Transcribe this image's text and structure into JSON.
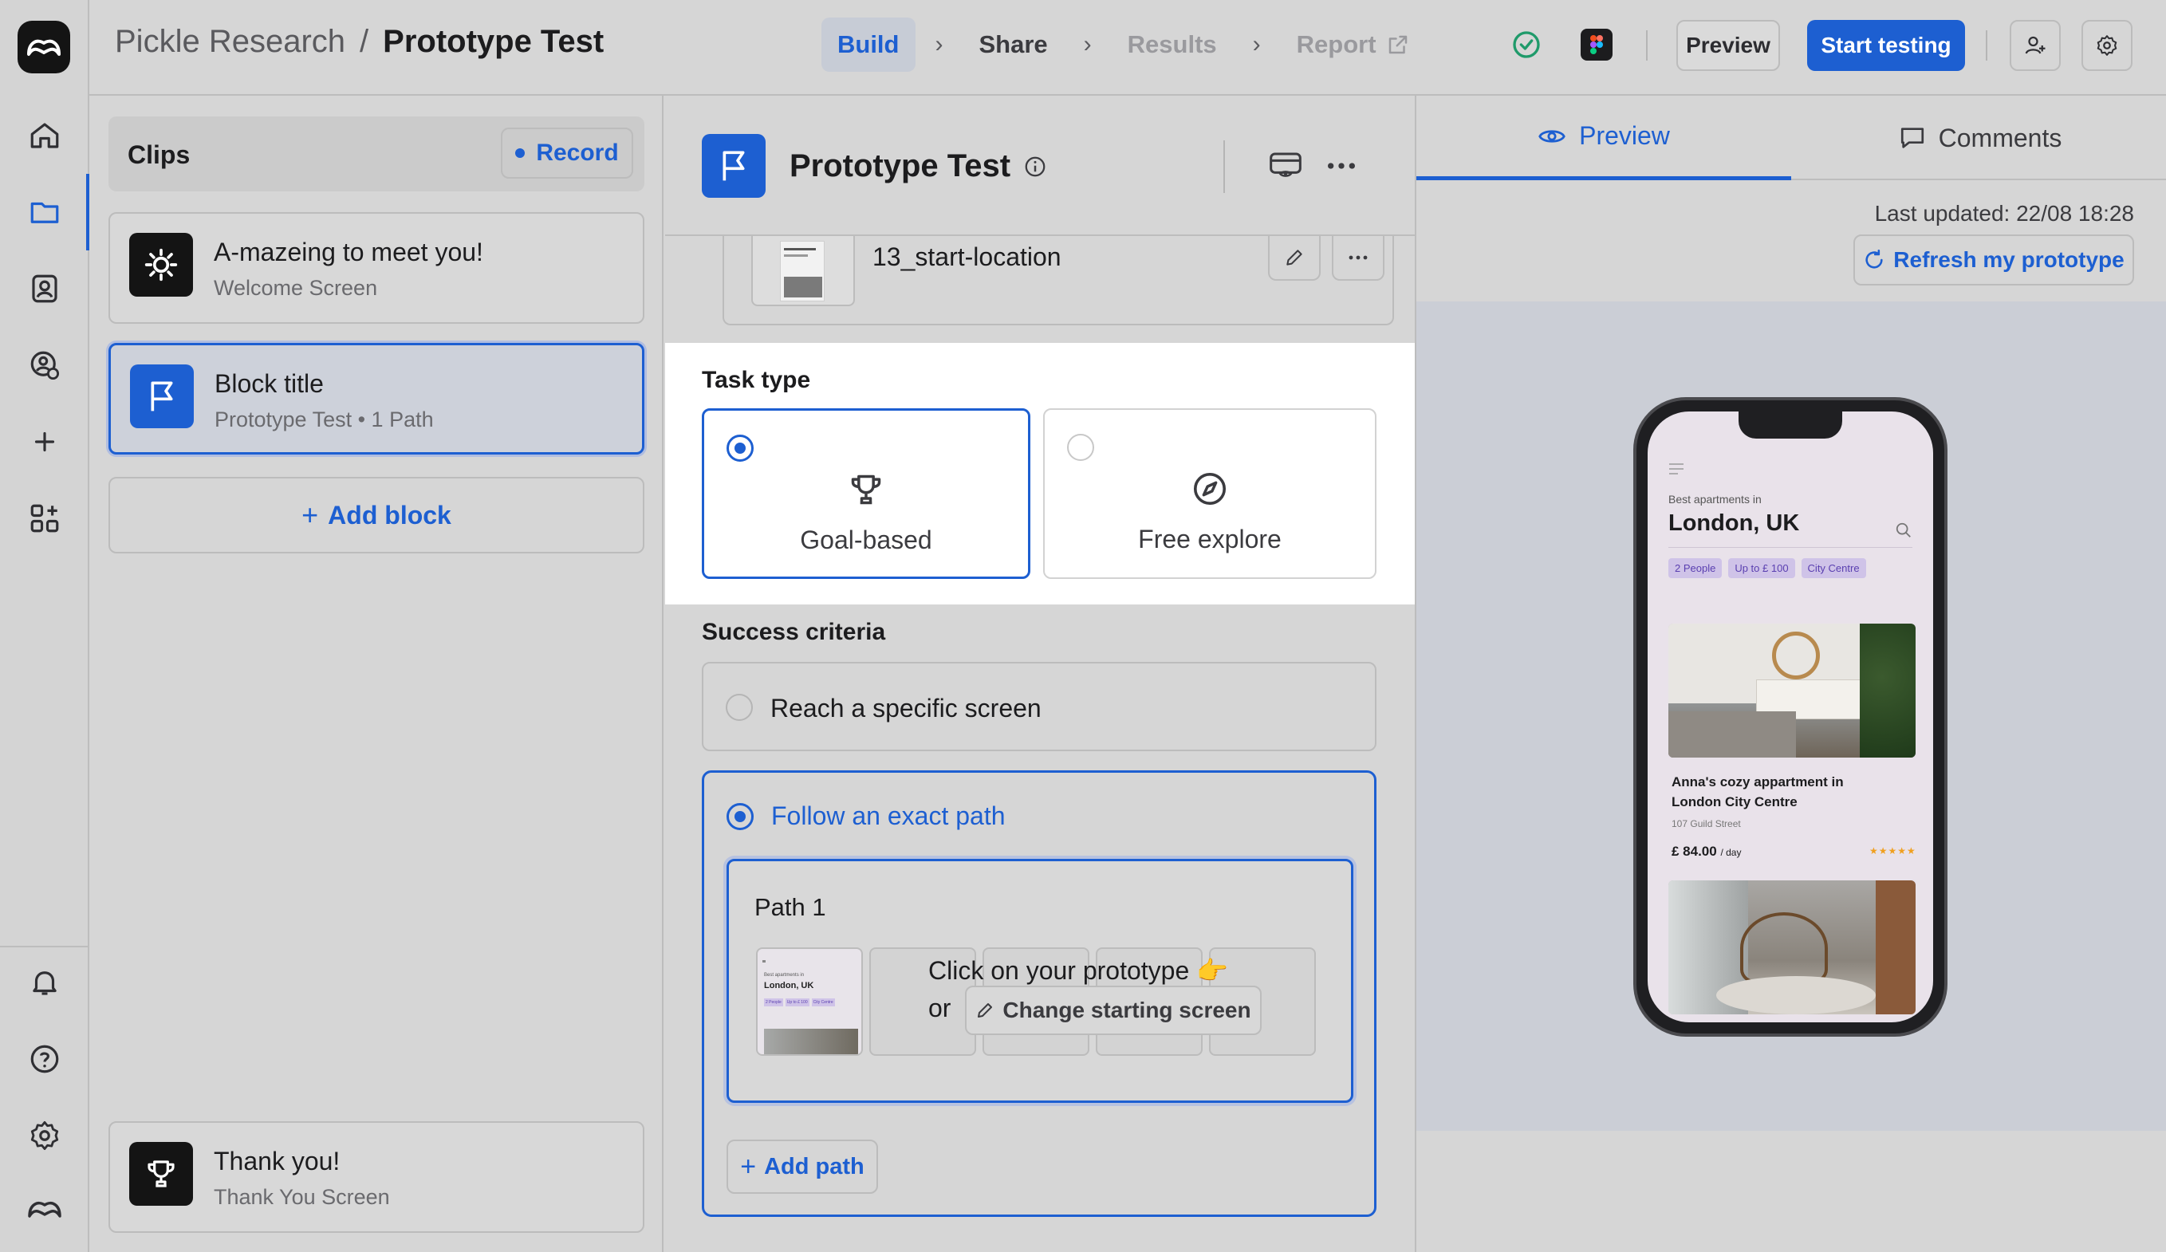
{
  "breadcrumb": {
    "org": "Pickle Research",
    "separator": "/",
    "project": "Prototype Test"
  },
  "steps": [
    {
      "label": "Build",
      "state": "active"
    },
    {
      "label": "Share",
      "state": "done"
    },
    {
      "label": "Results",
      "state": "disabled"
    },
    {
      "label": "Report",
      "state": "disabled"
    }
  ],
  "toolbar": {
    "preview_label": "Preview",
    "start_label": "Start testing"
  },
  "clips": {
    "title": "Clips",
    "record_label": "Record",
    "blocks": [
      {
        "title": "A-mazeing to meet you!",
        "subtitle": "Welcome Screen",
        "icon": "sun-icon"
      },
      {
        "title": "Block title",
        "subtitle": "Prototype Test • 1 Path",
        "icon": "flag-icon"
      }
    ],
    "add_block_label": "Add block",
    "end_block": {
      "title": "Thank you!",
      "subtitle": "Thank You Screen",
      "icon": "trophy-icon"
    }
  },
  "editor": {
    "title": "Prototype Test",
    "start_screen_name": "13_start-location",
    "task_type_label": "Task type",
    "task_types": [
      {
        "label": "Goal-based",
        "selected": true
      },
      {
        "label": "Free explore",
        "selected": false
      }
    ],
    "success_label": "Success criteria",
    "criteria": [
      {
        "label": "Reach a specific screen",
        "selected": false
      },
      {
        "label": "Follow an exact path",
        "selected": true
      }
    ],
    "path": {
      "title": "Path 1",
      "hint": "Click on your prototype 👉",
      "or": "or",
      "change_label": "Change starting screen"
    },
    "add_path_label": "Add path"
  },
  "right_panel": {
    "tabs": [
      {
        "label": "Preview"
      },
      {
        "label": "Comments"
      }
    ],
    "last_updated": "Last updated: 22/08 18:28",
    "refresh_label": "Refresh my prototype"
  },
  "phone": {
    "subtitle": "Best apartments in",
    "city": "London, UK",
    "chips": [
      "2 People",
      "Up to £ 100",
      "City Centre"
    ],
    "listing_title_line1": "Anna's cozy appartment in",
    "listing_title_line2": "London City Centre",
    "address": "107  Guild Street",
    "price": "£ 84.00",
    "price_unit": "/ day",
    "rating": "★★★★★"
  },
  "thumb": {
    "subtitle": "Best apartments in",
    "city": "London, UK",
    "chips": [
      "2 People",
      "Up to £ 100",
      "City Centre"
    ]
  },
  "colors": {
    "accent": "#1d5fd1",
    "rail_bg": "#d4d4d4",
    "dark_icon_bg": "#141414"
  }
}
